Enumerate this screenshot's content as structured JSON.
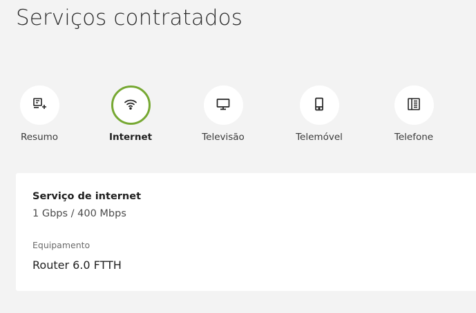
{
  "page": {
    "title": "Serviços contratados"
  },
  "tabs": [
    {
      "label": "Resumo",
      "icon": "summary-icon",
      "active": false
    },
    {
      "label": "Internet",
      "icon": "wifi-icon",
      "active": true
    },
    {
      "label": "Televisão",
      "icon": "tv-icon",
      "active": false
    },
    {
      "label": "Telemóvel",
      "icon": "mobile-phone-icon",
      "active": false
    },
    {
      "label": "Telefone",
      "icon": "landline-phone-icon",
      "active": false
    }
  ],
  "service": {
    "title": "Serviço de internet",
    "speed": "1 Gbps / 400 Mbps",
    "equipment_label": "Equipamento",
    "equipment_value": "Router 6.0 FTTH"
  },
  "colors": {
    "active_ring": "#76a832",
    "background": "#f3f3f3",
    "card": "#ffffff"
  }
}
